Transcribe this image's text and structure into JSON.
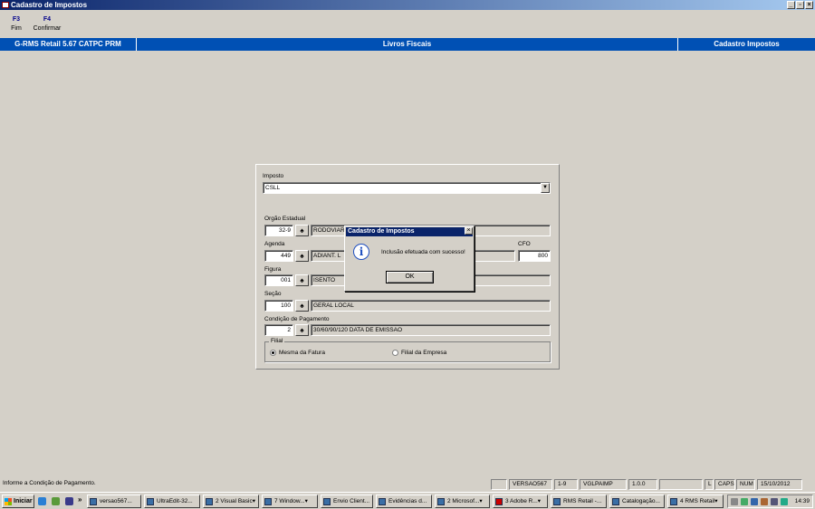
{
  "window": {
    "title": "Cadastro de Impostos"
  },
  "toolbar": {
    "keys": [
      {
        "key": "F3",
        "label": "Fim"
      },
      {
        "key": "F4",
        "label": "Confirmar"
      }
    ]
  },
  "banner": {
    "left": "G-RMS Retail 5.67 CATPC PRM",
    "center": "Livros Fiscais",
    "right": "Cadastro Impostos"
  },
  "form": {
    "imposto": {
      "label": "Imposto",
      "value": "CSLL"
    },
    "orgao": {
      "label": "Orgão Estadual",
      "code": "32-9",
      "desc": "RODOVIAR"
    },
    "agenda": {
      "label": "Agenda",
      "code": "449",
      "desc": "ADIANT. L"
    },
    "cfo": {
      "label": "CFO",
      "value": "800"
    },
    "figura": {
      "label": "Figura",
      "code": "001",
      "desc": "ISENTO"
    },
    "secao": {
      "label": "Seção",
      "code": "100",
      "desc": "GERAL LOCAL"
    },
    "condicao": {
      "label": "Condição de Pagamento",
      "code": "2",
      "desc": "30/60/90/120 DATA DE EMISSAO"
    },
    "filial": {
      "label": "Filial",
      "options": [
        "Mesma da Fatura",
        "Filial da Empresa"
      ],
      "selected": "Mesma da Fatura"
    }
  },
  "dialog": {
    "title": "Cadastro de Impostos",
    "message": "Inclusão efetuada com sucesso!",
    "ok": "OK",
    "icon": "info-icon"
  },
  "statusbar": {
    "message": "Informe a Condição de Pagamento.",
    "panels": [
      "VERSAO567",
      "1-9",
      "VGLPAIMP",
      "1.0.0",
      "L",
      "CAPS",
      "NUM",
      "15/10/2012"
    ]
  },
  "taskbar": {
    "start": "Iniciar",
    "tasks": [
      "versao567...",
      "UltraEdit-32...",
      "2 Visual Basic",
      "7 Window...",
      "Envio Client...",
      "Evidências d...",
      "2 Microsof...",
      "3 Adobe R...",
      "RMS Retail -...",
      "Catalogação...",
      "4 RMS Retail"
    ],
    "clock": "14:39"
  },
  "colors": {
    "banner": "#0050b4",
    "titlebar": "#0a246a",
    "face": "#d4d0c8"
  }
}
